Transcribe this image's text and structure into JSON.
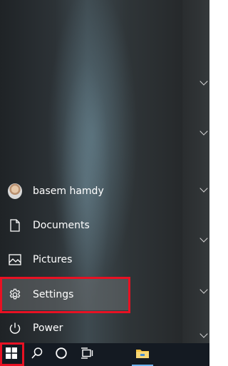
{
  "start_menu": {
    "user": {
      "name": "basem hamdy",
      "icon": "user-avatar"
    },
    "items": [
      {
        "label": "Documents",
        "icon": "document-icon"
      },
      {
        "label": "Pictures",
        "icon": "pictures-icon"
      },
      {
        "label": "Settings",
        "icon": "gear-icon"
      },
      {
        "label": "Power",
        "icon": "power-icon"
      }
    ]
  },
  "taskbar": {
    "buttons": [
      {
        "name": "start",
        "icon": "windows-logo-icon"
      },
      {
        "name": "search",
        "icon": "search-icon"
      },
      {
        "name": "cortana",
        "icon": "circle-icon"
      },
      {
        "name": "task-view",
        "icon": "task-view-icon"
      },
      {
        "name": "file-explorer",
        "icon": "folder-icon"
      }
    ]
  },
  "colors": {
    "highlight_border": "#e81123",
    "taskbar": "#141a22",
    "folder": "#f5c242",
    "accent_underline": "#6fb4ee"
  }
}
